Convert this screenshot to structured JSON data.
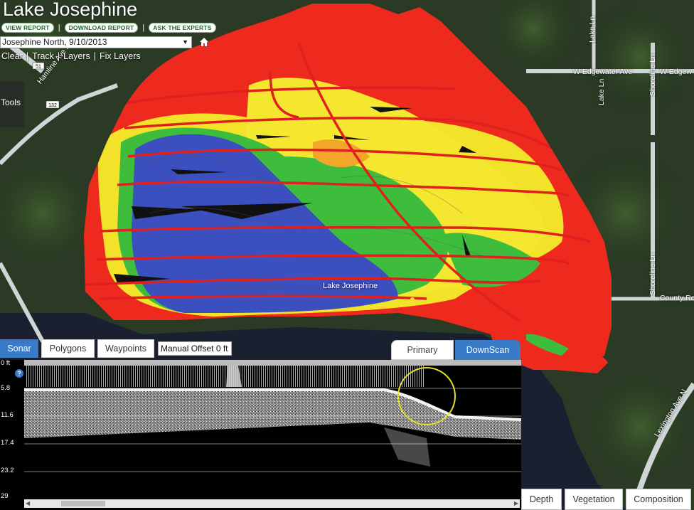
{
  "app": {
    "title": "Lake Josephine"
  },
  "links": {
    "view_report": "VIEW REPORT",
    "download_report": "DOWNLOAD REPORT",
    "ask_experts": "ASK THE EXPERTS",
    "separator": "|"
  },
  "trip_select": {
    "value": "Josephine North, 9/10/2013"
  },
  "toolbar": {
    "clear": "Clear",
    "track": "Track",
    "layers": "Layers",
    "fix_layers": "Fix Layers",
    "separator": "|"
  },
  "tools_panel": {
    "label": "Tools"
  },
  "map": {
    "lake_label": "Lake Josephine",
    "streets": {
      "hamline": "Hamline Ave N",
      "edgewater1": "W Edgewater Ave",
      "edgewater2": "W Edgew",
      "lake_ln_top": "Lake Ln",
      "lake_ln": "Lake Ln",
      "shoreline_top": "Shoreline Ln",
      "shoreline_bottom": "Shoreline Ln",
      "county_road": "County Ro",
      "lexington": "Lexington Ave N"
    },
    "route_shields": {
      "r51": "51",
      "r132": "132"
    },
    "colors": {
      "deep": "#3b4fbf",
      "shallow": "#ee2a1e",
      "mid": "#f2e52a",
      "green": "#3fbf3a",
      "track": "#e0201e"
    }
  },
  "sonar": {
    "tabs": {
      "sonar": "Sonar",
      "polygons": "Polygons",
      "waypoints": "Waypoints"
    },
    "manual_offset": "Manual Offset 0 ft",
    "views": {
      "primary": "Primary",
      "downscan": "DownScan"
    },
    "depth_labels": [
      "0 ft",
      "5.8",
      "11.6",
      "17.4",
      "23.2",
      "29"
    ],
    "help_icon": "?"
  },
  "bottom_buttons": {
    "depth": "Depth",
    "vegetation": "Vegetation",
    "composition": "Composition"
  }
}
